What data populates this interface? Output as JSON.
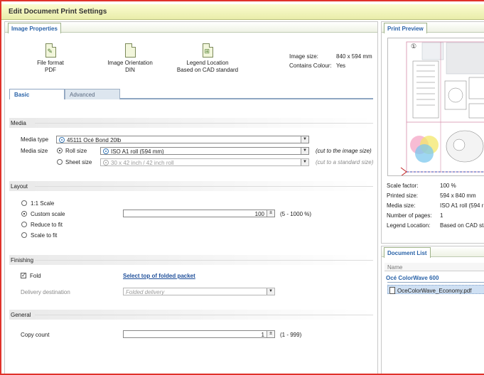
{
  "window": {
    "title": "Edit Document Print Settings"
  },
  "image_properties": {
    "tab_label": "Image Properties",
    "file_format": {
      "label": "File format",
      "value": "PDF"
    },
    "orientation": {
      "label": "Image Orientation",
      "value": "DIN"
    },
    "legend": {
      "label": "Legend Location",
      "value": "Based on CAD standard"
    },
    "image_size": {
      "label": "Image size:",
      "value": "840 x 594 mm"
    },
    "contains_colour": {
      "label": "Contains Colour:",
      "value": "Yes"
    }
  },
  "inner_tabs": {
    "basic": "Basic",
    "advanced": "Advanced"
  },
  "media": {
    "section": "Media",
    "type_label": "Media type",
    "type_value": "45111 Océ Bond 20lb",
    "size_label": "Media size",
    "roll_label": "Roll size",
    "roll_value": "ISO A1 roll (594 mm)",
    "roll_hint": "(cut to the image size)",
    "sheet_label": "Sheet size",
    "sheet_value": "30 x 42 inch / 42 inch roll",
    "sheet_hint": "(cut to a standard size)"
  },
  "layout": {
    "section": "Layout",
    "opt_1to1": "1:1 Scale",
    "opt_custom": "Custom scale",
    "opt_reduce": "Reduce to fit",
    "opt_scale": "Scale to fit",
    "custom_value": "100",
    "custom_range": "(5 - 1000 %)"
  },
  "finishing": {
    "section": "Finishing",
    "fold_label": "Fold",
    "select_top_link": "Select top of folded packet",
    "delivery_label": "Delivery destination",
    "delivery_value": "Folded delivery"
  },
  "general": {
    "section": "General",
    "copy_label": "Copy count",
    "copy_value": "1",
    "copy_range": "(1 - 999)"
  },
  "print_preview": {
    "tab_label": "Print Preview",
    "scale_factor": {
      "label": "Scale factor:",
      "value": "100 %"
    },
    "printed_size": {
      "label": "Printed size:",
      "value": "594 x 840 mm"
    },
    "media_size": {
      "label": "Media size:",
      "value": "ISO A1 roll (594 r"
    },
    "pages": {
      "label": "Number of pages:",
      "value": "1"
    },
    "legend": {
      "label": "Legend Location:",
      "value": "Based on CAD sta"
    }
  },
  "document_list": {
    "tab_label": "Document List",
    "column_name": "Name",
    "group": "Océ ColorWave 600",
    "file": "OceColorWave_Economy.pdf"
  },
  "colors": {
    "accent_red": "#e0322a",
    "link_blue": "#1f4f9a",
    "tab_blue": "#2a63a8",
    "selection": "#cfe0f3"
  }
}
